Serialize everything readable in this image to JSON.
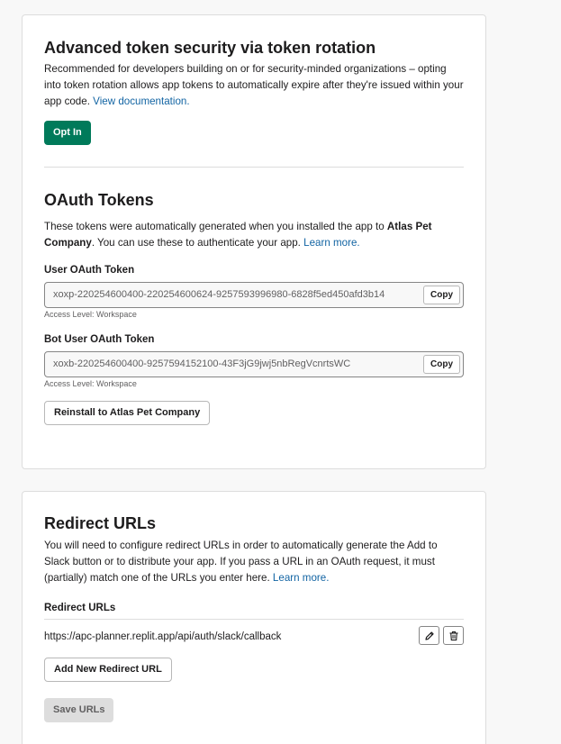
{
  "security": {
    "title": "Advanced token security via token rotation",
    "description": "Recommended for developers building on or for security-minded organizations – opting into token rotation allows app tokens to automatically expire after they're issued within your app code.",
    "doc_link": "View documentation.",
    "opt_in_label": "Opt In"
  },
  "oauth": {
    "title": "OAuth Tokens",
    "desc_prefix": "These tokens were automatically generated when you installed the app to",
    "workspace_name": "Atlas Pet Company",
    "desc_suffix": ". You can use these to authenticate your app.",
    "learn_more": "Learn more.",
    "user_token": {
      "label": "User OAuth Token",
      "value": "xoxp-220254600400-220254600624-9257593996980-6828f5ed450afd3b14",
      "copy_label": "Copy",
      "access_level": "Access Level: Workspace"
    },
    "bot_token": {
      "label": "Bot User OAuth Token",
      "value": "xoxb-220254600400-9257594152100-43F3jG9jwj5nbRegVcnrtsWC",
      "copy_label": "Copy",
      "access_level": "Access Level: Workspace"
    },
    "reinstall_label": "Reinstall to Atlas Pet Company"
  },
  "redirect": {
    "title": "Redirect URLs",
    "description": "You will need to configure redirect URLs in order to automatically generate the Add to Slack button or to distribute your app. If you pass a URL in an OAuth request, it must (partially) match one of the URLs you enter here.",
    "learn_more": "Learn more.",
    "list_label": "Redirect URLs",
    "urls": [
      "https://apc-planner.replit.app/api/auth/slack/callback"
    ],
    "add_label": "Add New Redirect URL",
    "save_label": "Save URLs"
  }
}
